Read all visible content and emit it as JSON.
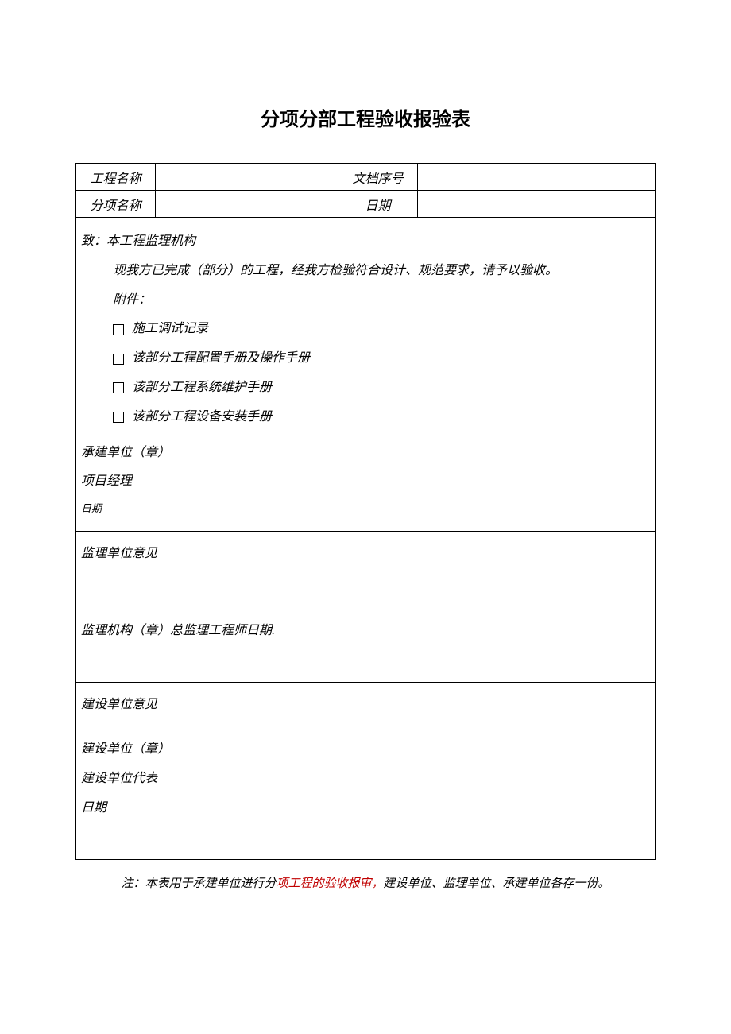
{
  "title": "分项分部工程验收报验表",
  "header": {
    "projectNameLabel": "工程名称",
    "docNoLabel": "文档序号",
    "subItemLabel": "分项名称",
    "dateLabel": "日期",
    "projectNameValue": "",
    "docNoValue": "",
    "subItemValue": "",
    "dateValue": ""
  },
  "body": {
    "addressee": "致：本工程监理机构",
    "intro": "现我方已完成（部分）的工程，经我方检验符合设计、规范要求，请予以验收。",
    "attachmentsLabel": "附件：",
    "checks": [
      "施工调试记录",
      "该部分工程配置手册及操作手册",
      "该部分工程系统维护手册",
      "该部分工程设备安装手册"
    ],
    "constructionUnit": "承建单位（章）",
    "projectManager": "项目经理",
    "dateLabel": "日期"
  },
  "supervision": {
    "opinionLabel": "监理单位意见",
    "signature": "监理机构（章）总监理工程师日期."
  },
  "construction": {
    "opinionLabel": "建设单位意见",
    "unit": "建设单位（章）",
    "rep": "建设单位代表",
    "dateLabel": "日期"
  },
  "footer": {
    "prefix": "注：本表用于承建单位进行分",
    "red": "项工程的验收报审，",
    "suffix": "建设单位、监理单位、承建单位各存一份。"
  }
}
